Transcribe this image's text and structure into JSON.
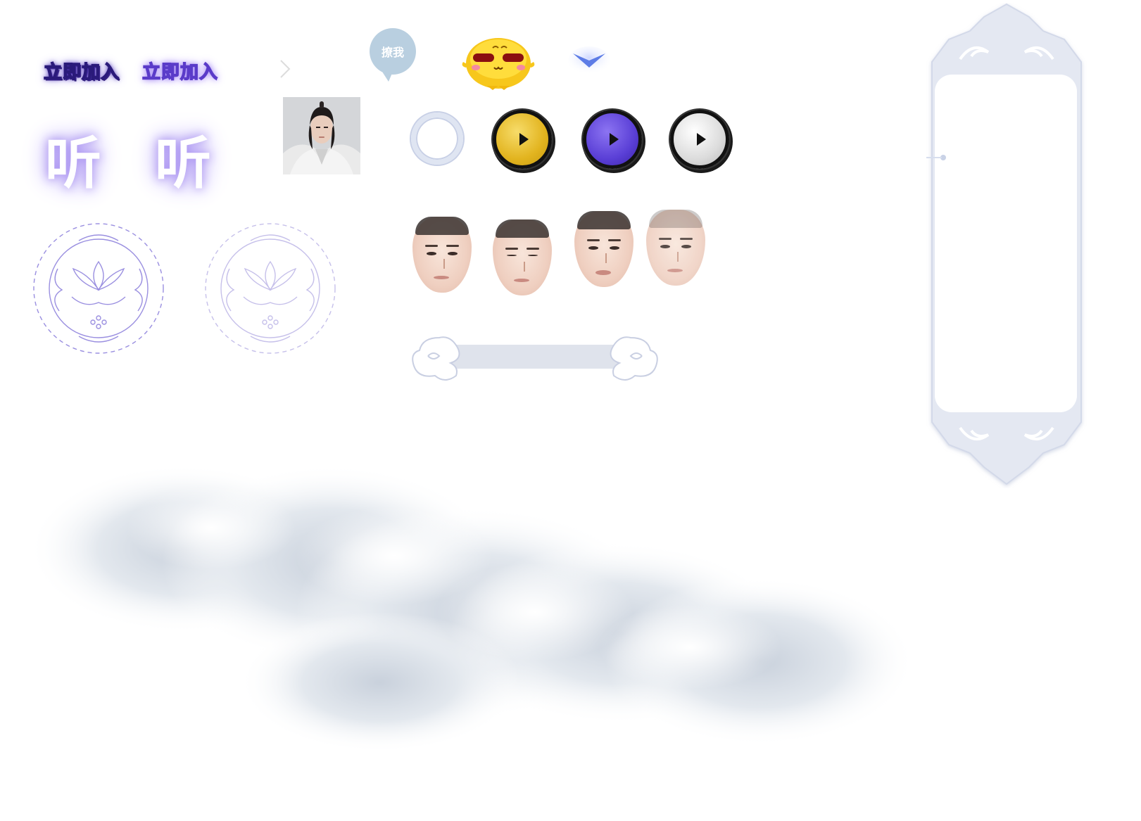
{
  "join_buttons": [
    "立即加入",
    "立即加入"
  ],
  "listen_glyphs": [
    "听",
    "听"
  ],
  "bubble_text": "撩我",
  "play_buttons": [
    {
      "name": "gold",
      "color": "#e8be2a"
    },
    {
      "name": "purple",
      "color": "#5a3fd6"
    },
    {
      "name": "silver",
      "color": "#d9d9d9"
    }
  ],
  "accent": "#5a3fd6"
}
